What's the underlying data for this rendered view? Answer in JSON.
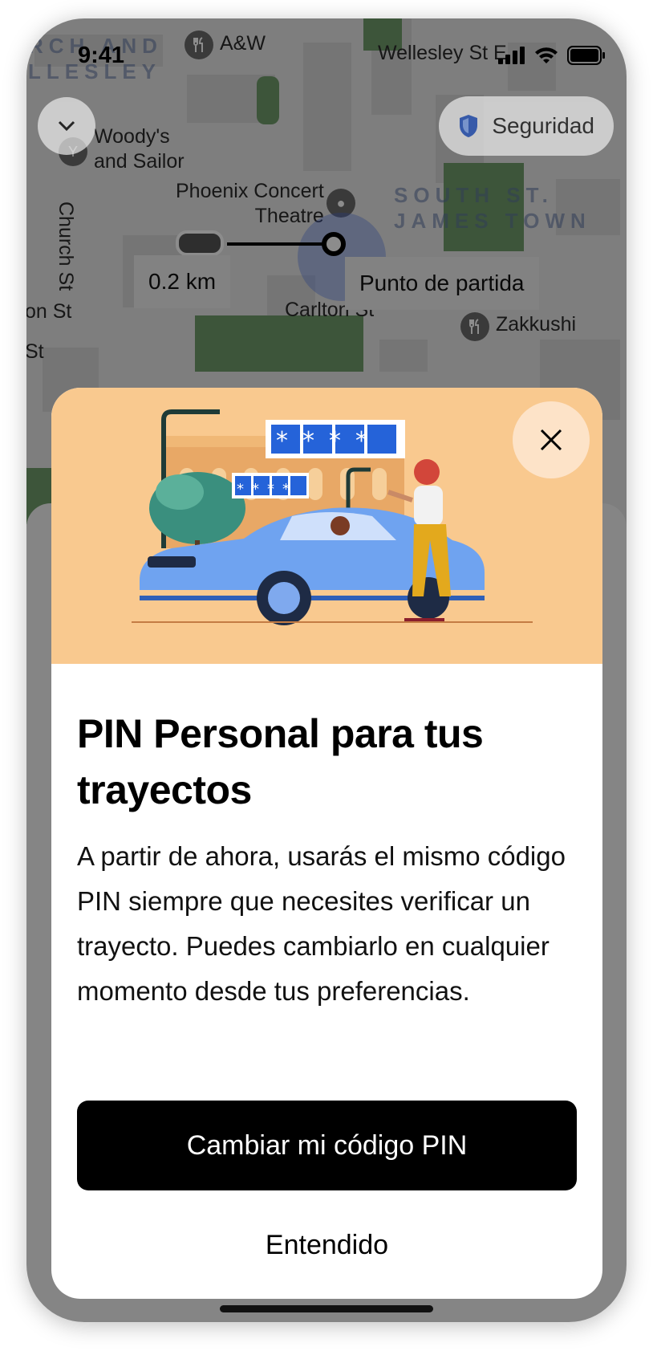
{
  "status_bar": {
    "time": "9:41"
  },
  "map": {
    "places": {
      "aw": "A&W",
      "woodys": "Woody's\nand Sailor",
      "phoenix": "Phoenix Concert\nTheatre",
      "zakkushi": "Zakkushi",
      "wellesley": "Wellesley St E"
    },
    "streets": {
      "church": "Church St",
      "carlton": "Carlton St",
      "on_st": "on St",
      "st": "St"
    },
    "districts": {
      "church_wellesley": "RCH AND\nLLESLEY",
      "south_st_james": "SOUTH ST.\nJAMES TOWN"
    },
    "distance_label": "0.2 km",
    "pickup_label": "Punto de partida",
    "safety_button": "Seguridad"
  },
  "modal": {
    "title": "PIN Personal para tus trayectos",
    "body": "A partir de ahora, usarás el mismo código PIN siempre que necesites verificar un trayecto. Puedes cambiarlo en cualquier momento desde tus preferencias.",
    "primary_button": "Cambiar mi código PIN",
    "secondary_button": "Entendido",
    "illustration": {
      "big_pin": "****",
      "small_pin": "****"
    }
  },
  "colors": {
    "hero_bg": "#f9c98f",
    "car_blue": "#6fa3f0",
    "pin_blue": "#2563d9",
    "park_green": "#6f9c6a",
    "button_black": "#000000"
  },
  "icons": [
    "chevron-down-icon",
    "shield-icon",
    "close-icon",
    "restaurant-icon",
    "location-pin-icon",
    "signal-icon",
    "wifi-icon",
    "battery-icon"
  ]
}
